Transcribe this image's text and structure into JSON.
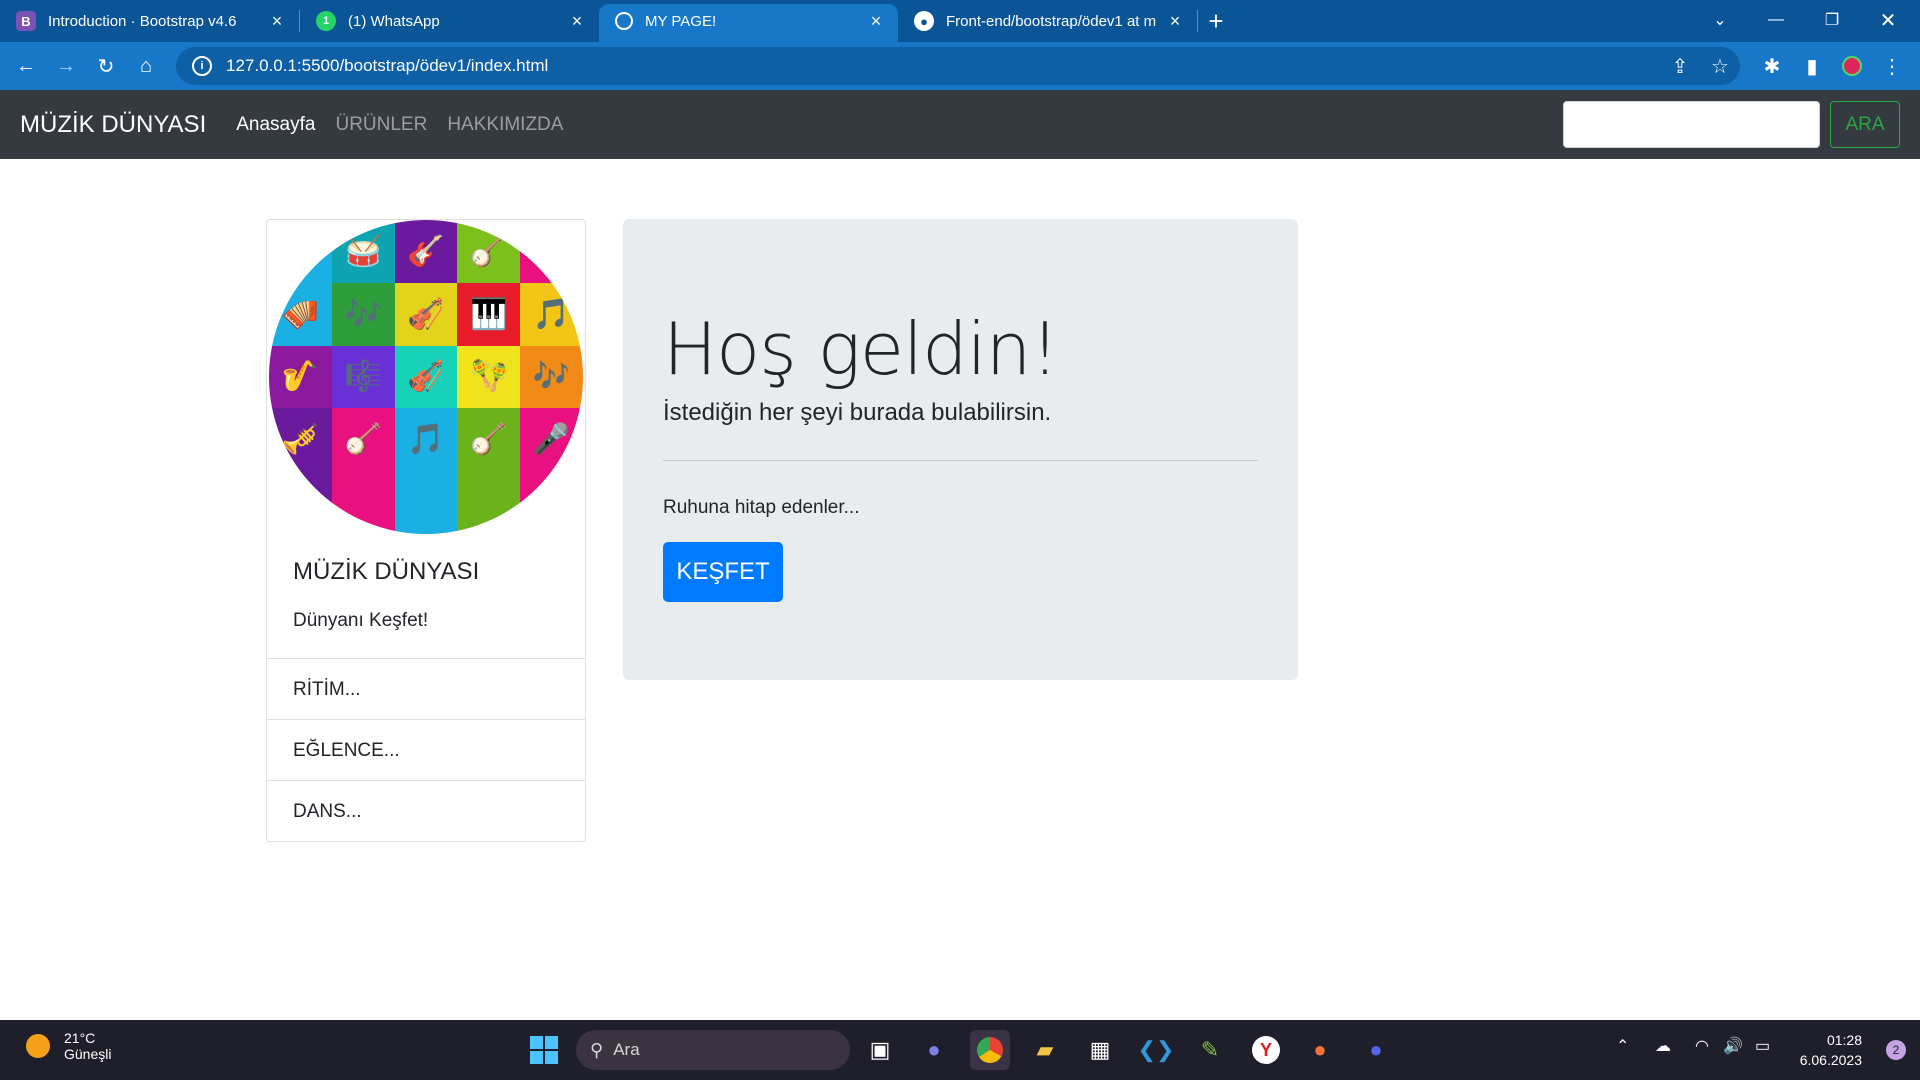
{
  "browser": {
    "tabs": [
      {
        "title": "Introduction · Bootstrap v4.6",
        "favicon": "bootstrap-icon",
        "active": false
      },
      {
        "title": "(1) WhatsApp",
        "favicon": "whatsapp-icon",
        "active": false
      },
      {
        "title": "MY PAGE!",
        "favicon": "globe-icon",
        "active": true
      },
      {
        "title": "Front-end/bootstrap/ödev1 at m",
        "favicon": "github-icon",
        "active": false
      }
    ],
    "url": "127.0.0.1:5500/bootstrap/ödev1/index.html"
  },
  "navbar": {
    "brand": "MÜZİK DÜNYASI",
    "links": [
      "Anasayfa",
      "ÜRÜNLER",
      "HAKKIMIZDA"
    ],
    "search_button": "ARA"
  },
  "card": {
    "title": "MÜZİK DÜNYASI",
    "text": "Dünyanı Keşfet!",
    "items": [
      "RİTİM...",
      "EĞLENCE...",
      "DANS..."
    ]
  },
  "jumbotron": {
    "heading": "Hoş geldin!",
    "lead": "İstediğin her şeyi burada bulabilirsin.",
    "text": "Ruhuna hitap edenler...",
    "button": "KEŞFET"
  },
  "taskbar": {
    "weather_temp": "21°C",
    "weather_desc": "Güneşli",
    "search_placeholder": "Ara",
    "time": "01:28",
    "date": "6.06.2023",
    "notifications": "2"
  },
  "colors": {
    "navbar_bg": "#343a40",
    "primary": "#007bff",
    "success": "#28a745",
    "jumbotron_bg": "#e9ecef",
    "tabstrip_bg": "#0a5597",
    "active_tab_bg": "#1778c9"
  }
}
